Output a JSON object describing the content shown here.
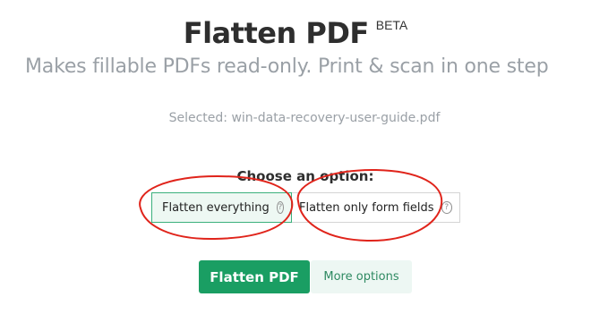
{
  "header": {
    "title": "Flatten PDF",
    "badge": "BETA",
    "subtitle": "Makes fillable PDFs read-only. Print & scan in one step"
  },
  "file": {
    "selected_text": "Selected: win-data-recovery-user-guide.pdf"
  },
  "options": {
    "label": "Choose an option:",
    "items": [
      {
        "label": "Flatten everything",
        "selected": true,
        "help_icon": "question-circle-icon"
      },
      {
        "label": "Flatten only form fields",
        "selected": false,
        "help_icon": "question-circle-icon"
      }
    ]
  },
  "actions": {
    "primary_label": "Flatten PDF",
    "secondary_label": "More options"
  },
  "annotations": {
    "color": "#e0241b",
    "shape": "hand-drawn ellipse",
    "count": 2
  },
  "colors": {
    "accent": "#1a9e63",
    "accent_light": "#eef8f3",
    "muted_text": "#9aa0a6"
  }
}
